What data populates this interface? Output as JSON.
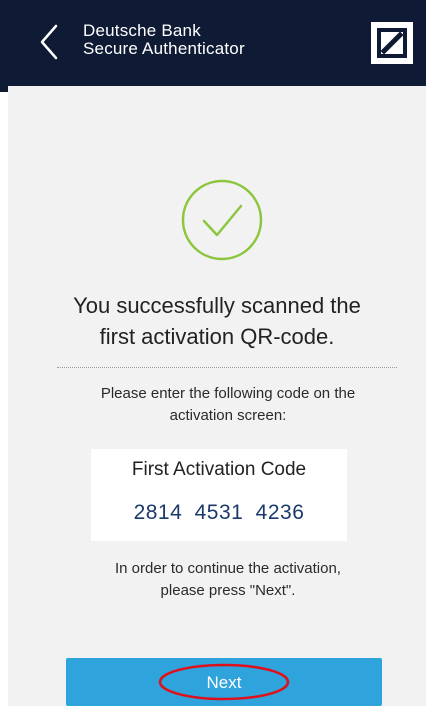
{
  "header": {
    "title_line1": "Deutsche Bank",
    "title_line2": "Secure Authenticator",
    "back_icon": "chevron-left-icon",
    "logo_icon": "deutsche-bank-logo"
  },
  "main": {
    "status_icon": "check-circle-icon",
    "heading": "You successfully scanned the\nfirst activation QR-code.",
    "instruction": "Please enter the following code on the\nactivation screen:",
    "code_card": {
      "label": "First Activation Code",
      "value": "2814 4531 4236"
    },
    "continue_text": "In order to continue the activation,\nplease press \"Next\".",
    "next_label": "Next"
  },
  "colors": {
    "header_bg": "#0f1a35",
    "success_green": "#8cc63f",
    "button_blue": "#2ea3dc",
    "code_blue": "#1a3a6b",
    "highlight_red": "#e0101a"
  }
}
